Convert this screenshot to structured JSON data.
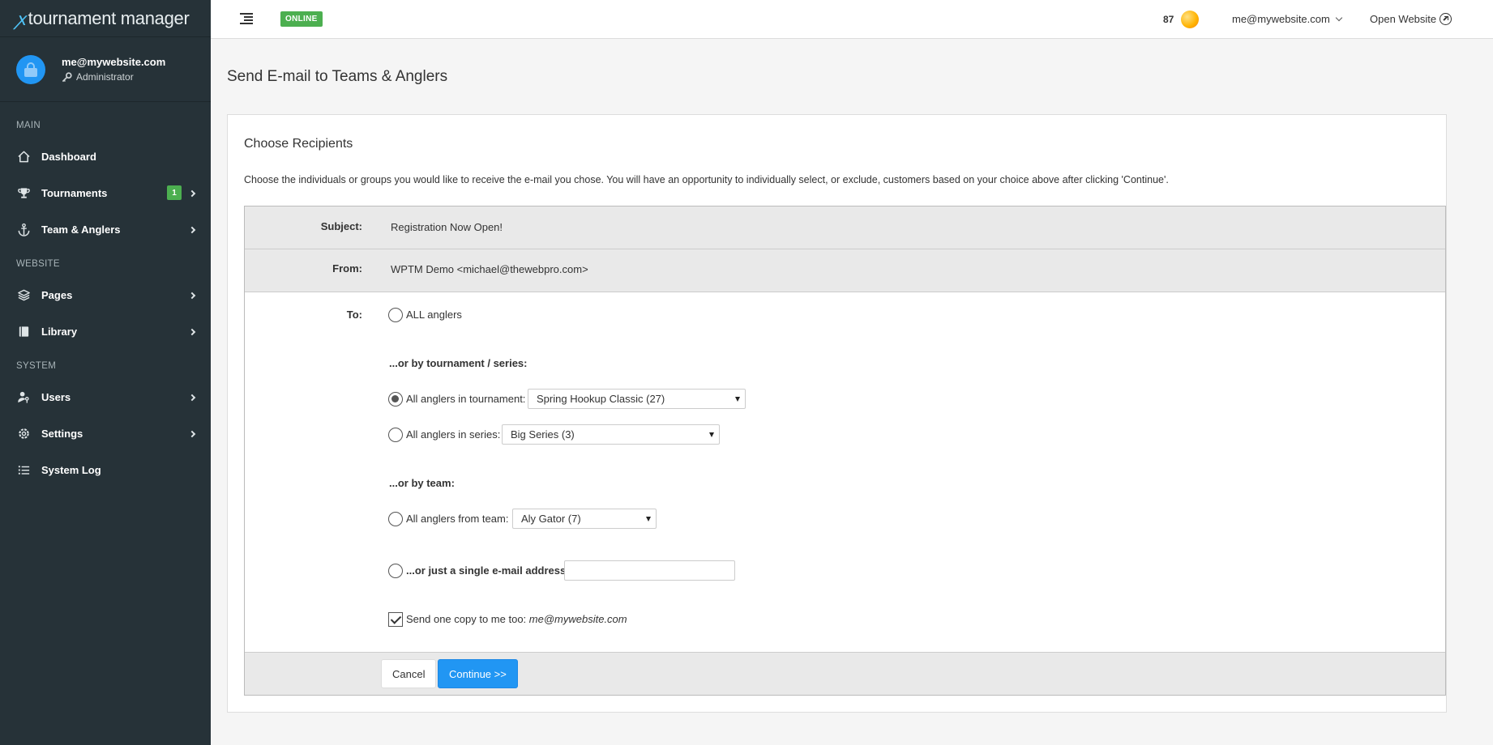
{
  "app": {
    "logo_mark": "ꭗ",
    "logo_text": "tournament manager"
  },
  "sidebar": {
    "user_email": "me@mywebsite.com",
    "user_role": "Administrator",
    "sections": {
      "main": "MAIN",
      "website": "WEBSITE",
      "system": "SYSTEM"
    },
    "items": {
      "dashboard": "Dashboard",
      "tournaments": "Tournaments",
      "tournaments_badge": "1",
      "team_anglers": "Team & Anglers",
      "pages": "Pages",
      "library": "Library",
      "users": "Users",
      "settings": "Settings",
      "system_log": "System Log"
    },
    "icons": {
      "dashboard": "home-icon",
      "tournaments": "trophy-icon",
      "team_anglers": "anchor-icon",
      "pages": "layers-icon",
      "library": "book-icon",
      "users": "user-key-icon",
      "settings": "gear-icon",
      "system_log": "list-icon"
    }
  },
  "header": {
    "status": "ONLINE",
    "credits": "87",
    "user_email": "me@mywebsite.com",
    "open_website": "Open Website"
  },
  "main": {
    "page_title": "Send E-mail to Teams & Anglers",
    "panel_title": "Choose Recipients",
    "description": "Choose the individuals or groups you would like to receive the e-mail you chose. You will have an opportunity to individually select, or exclude, customers based on your choice above after clicking 'Continue'.",
    "form": {
      "subject_label": "Subject:",
      "subject_value": "Registration Now Open!",
      "from_label": "From:",
      "from_value": "WPTM Demo <michael@thewebpro.com>",
      "to_label": "To:",
      "all_anglers": "ALL anglers",
      "by_tournament_heading": "...or by tournament / series:",
      "in_tournament_label": "All anglers in tournament:",
      "tournament_selected": "Spring Hookup Classic (27)",
      "in_series_label": "All anglers in series:",
      "series_selected": "Big Series (3)",
      "by_team_heading": "...or by team:",
      "from_team_label": "All anglers from team:",
      "team_selected": "Aly Gator (7)",
      "single_email_label": "...or just a single e-mail address:",
      "single_email_value": "",
      "copy_label": "Send one copy to me too:",
      "copy_email": "me@mywebsite.com",
      "selected_option": "tournament",
      "copy_checked": true
    },
    "buttons": {
      "cancel": "Cancel",
      "continue": "Continue >>"
    }
  },
  "colors": {
    "sidebar_bg": "#263238",
    "accent": "#2196f3",
    "online_green": "#4caf50"
  }
}
